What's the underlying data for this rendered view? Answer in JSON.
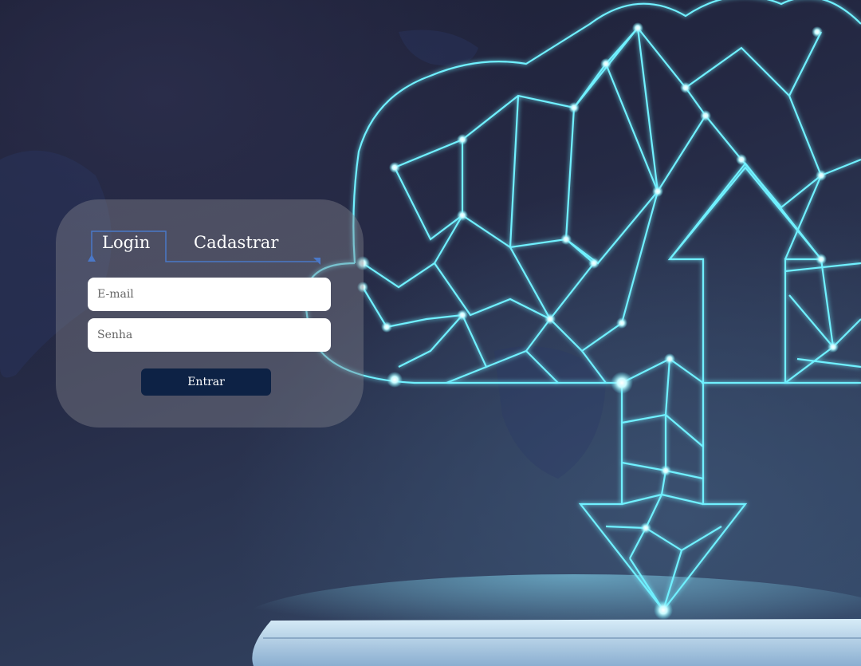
{
  "tabs": {
    "login_label": "Login",
    "signup_label": "Cadastrar",
    "active": "login"
  },
  "form": {
    "email_placeholder": "E-mail",
    "password_placeholder": "Senha",
    "submit_label": "Entrar"
  },
  "colors": {
    "accent": "#4a78c8",
    "button": "#0d2245",
    "glow": "#5fe6f5"
  },
  "background": {
    "illustration": "cloud-upload-download-network"
  }
}
